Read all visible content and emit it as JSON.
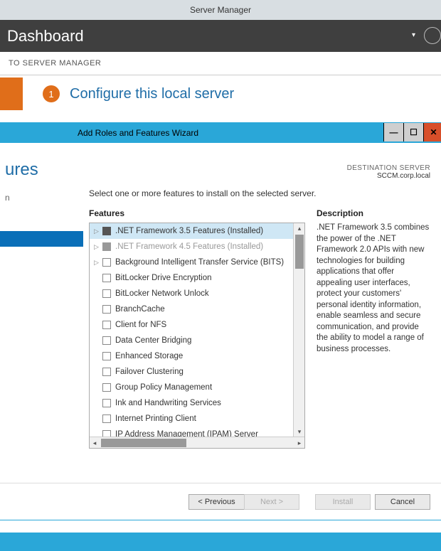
{
  "sm": {
    "title": "Server Manager",
    "header": "Dashboard",
    "welcome": "TO SERVER MANAGER",
    "step_num": "1",
    "step_text": "Configure this local server"
  },
  "wizard": {
    "title": "Add Roles and Features Wizard",
    "page_title": "ures",
    "dest_label": "DESTINATION SERVER",
    "dest_value": "SCCM.corp.local",
    "intro": "Select one or more features to install on the selected server.",
    "features_header": "Features",
    "desc_header": "Description",
    "sidebar": {
      "partial_item": "n"
    },
    "desc_text": ".NET Framework 3.5 combines the power of the .NET Framework 2.0 APIs with new technologies for building applications that offer appealing user interfaces, protect your customers' personal identity information, enable seamless and secure communication, and provide the ability to model a range of business processes.",
    "features": [
      {
        "label": ".NET Framework 3.5 Features (Installed)",
        "expandable": true,
        "tri": true,
        "selected": true
      },
      {
        "label": ".NET Framework 4.5 Features (Installed)",
        "expandable": true,
        "tri": true,
        "disabled": true
      },
      {
        "label": "Background Intelligent Transfer Service (BITS)",
        "expandable": true
      },
      {
        "label": "BitLocker Drive Encryption"
      },
      {
        "label": "BitLocker Network Unlock"
      },
      {
        "label": "BranchCache"
      },
      {
        "label": "Client for NFS"
      },
      {
        "label": "Data Center Bridging"
      },
      {
        "label": "Enhanced Storage"
      },
      {
        "label": "Failover Clustering"
      },
      {
        "label": "Group Policy Management"
      },
      {
        "label": "Ink and Handwriting Services"
      },
      {
        "label": "Internet Printing Client"
      },
      {
        "label": "IP Address Management (IPAM) Server"
      }
    ],
    "buttons": {
      "previous": "< Previous",
      "next": "Next >",
      "install": "Install",
      "cancel": "Cancel"
    }
  }
}
